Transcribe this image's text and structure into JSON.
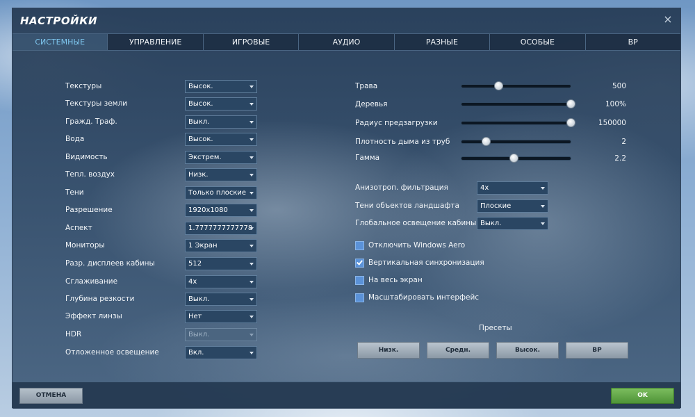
{
  "window": {
    "title": "НАСТРОЙКИ",
    "close_glyph": "×"
  },
  "tabs": [
    {
      "label": "СИСТЕМНЫЕ",
      "active": true
    },
    {
      "label": "УПРАВЛЕНИЕ",
      "active": false
    },
    {
      "label": "ИГРОВЫЕ",
      "active": false
    },
    {
      "label": "АУДИО",
      "active": false
    },
    {
      "label": "РАЗНЫЕ",
      "active": false
    },
    {
      "label": "ОСОБЫЕ",
      "active": false
    },
    {
      "label": "ВР",
      "active": false
    }
  ],
  "left_settings": [
    {
      "label": "Текстуры",
      "value": "Высок."
    },
    {
      "label": "Текстуры земли",
      "value": "Высок."
    },
    {
      "label": "Гражд. Траф.",
      "value": "Выкл."
    },
    {
      "label": "Вода",
      "value": "Высок."
    },
    {
      "label": "Видимость",
      "value": "Экстрем."
    },
    {
      "label": "Тепл. воздух",
      "value": "Низк."
    },
    {
      "label": "Тени",
      "value": "Только плоские"
    },
    {
      "label": "Разрешение",
      "value": "1920x1080"
    },
    {
      "label": "Аспект",
      "value": "1.7777777777778"
    },
    {
      "label": "Мониторы",
      "value": "1 Экран"
    },
    {
      "label": "Разр. дисплеев кабины",
      "value": "512"
    },
    {
      "label": "Сглаживание",
      "value": "4x"
    },
    {
      "label": "Глубина резкости",
      "value": "Выкл."
    },
    {
      "label": "Эффект линзы",
      "value": "Нет"
    },
    {
      "label": "HDR",
      "value": "Выкл.",
      "disabled": true
    },
    {
      "label": "Отложенное освещение",
      "value": "Вкл."
    }
  ],
  "sliders": [
    {
      "label": "Трава",
      "value": "500",
      "level_percent": 34
    },
    {
      "label": "Деревья",
      "value": "100%",
      "level_percent": 100
    },
    {
      "label": "Радиус предзагрузки",
      "value": "150000",
      "level_percent": 100
    },
    {
      "label": "Плотность дыма из труб",
      "value": "2",
      "level_percent": 22
    },
    {
      "label": "Гамма",
      "value": "2.2",
      "level_percent": 48
    }
  ],
  "right_settings": [
    {
      "label": "Анизотроп. фильтрация",
      "value": "4x"
    },
    {
      "label": "Тени объектов ландшафта",
      "value": "Плоские"
    },
    {
      "label": "Глобальное освещение кабины",
      "value": "Выкл."
    }
  ],
  "checkboxes": [
    {
      "label": "Отключить Windows Aero",
      "checked": false
    },
    {
      "label": "Вертикальная синхронизация",
      "checked": true
    },
    {
      "label": "На весь экран",
      "checked": false
    },
    {
      "label": "Масштабировать интерфейс",
      "checked": false
    }
  ],
  "presets": {
    "label": "Пресеты",
    "buttons": [
      "Низк.",
      "Средн.",
      "Высок.",
      "ВР"
    ]
  },
  "footer": {
    "cancel_label": "ОТМЕНА",
    "ok_label": "OK"
  },
  "colors": {
    "accent_tab": "#7fc8f0",
    "ok_button": "#5fa845",
    "checkbox": "#5b92d8"
  }
}
